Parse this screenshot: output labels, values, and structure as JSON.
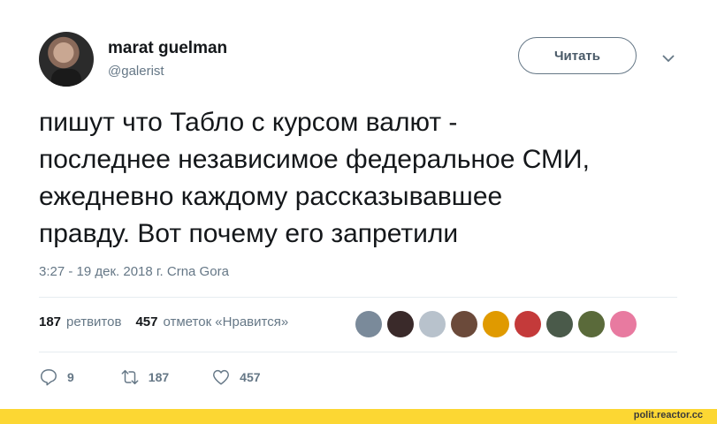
{
  "author": {
    "name": "marat guelman",
    "handle": "@galerist"
  },
  "follow_label": "Читать",
  "tweet": {
    "lines": [
      "пишут что Табло с курсом валют -",
      "последнее независимое федеральное СМИ,",
      "ежедневно каждому рассказывавшее",
      "правду. Вот почему его запретили"
    ]
  },
  "meta": "3:27 - 19 дек. 2018 г. Crna Gora",
  "stats": {
    "retweets_count": "187",
    "retweets_label": "ретвитов",
    "likes_count": "457",
    "likes_label": "отметок «Нравится»"
  },
  "likers": [
    "#7a8a9a",
    "#3a2a2a",
    "#b8c2cc",
    "#6b4a3a",
    "#e09a00",
    "#c43a3a",
    "#4a5a4a",
    "#5a6a3a",
    "#e87aa0"
  ],
  "actions": {
    "replies": "9",
    "retweets": "187",
    "likes": "457"
  },
  "footer": {
    "site": "polit.reactor.cc"
  },
  "colors": {
    "accent_footer": "#fcd733",
    "muted": "#657786",
    "text": "#14171a"
  }
}
